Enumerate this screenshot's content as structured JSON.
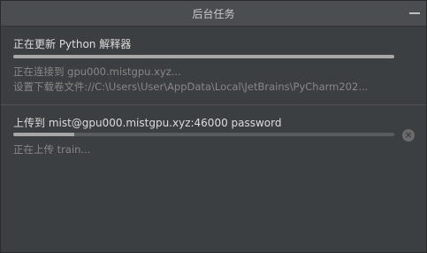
{
  "window": {
    "title": "后台任务"
  },
  "tasks": [
    {
      "title": "正在更新 Python 解释器",
      "progress": 1.0,
      "details": [
        "正在连接到 gpu000.mistgpu.xyz...",
        "设置下载卷文件://C:\\Users\\User\\AppData\\Local\\JetBrains\\PyCharm202..."
      ]
    },
    {
      "title": "上传到 mist@gpu000.mistgpu.xyz:46000 password",
      "progress": 0.16,
      "details": [
        "正在上传 train..."
      ],
      "cancel_icon": "×"
    }
  ],
  "colors": {
    "background": "#3c3f41",
    "titlebar": "#4b4e50",
    "progress_track": "#5a5d5f",
    "progress_fill": "#a8a8a8"
  }
}
